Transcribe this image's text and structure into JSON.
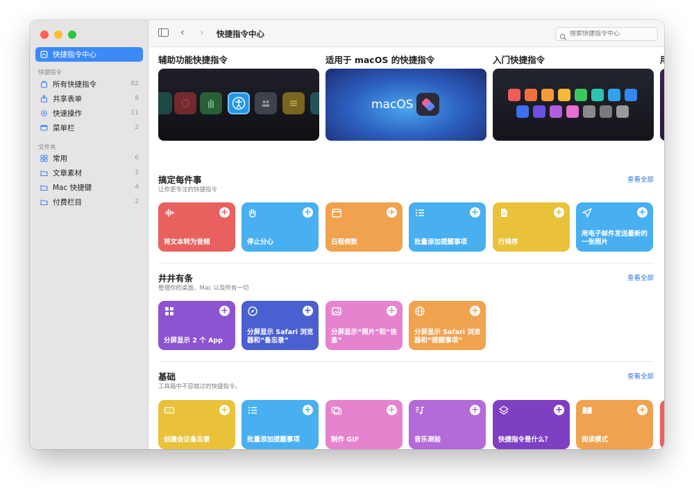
{
  "window": {
    "title": "快捷指令中心"
  },
  "sidebar": {
    "active": {
      "label": "快捷指令中心"
    },
    "section1": "快捷指令",
    "items1": [
      {
        "label": "所有快捷指令",
        "count": "82"
      },
      {
        "label": "共享表单",
        "count": "8"
      },
      {
        "label": "快速操作",
        "count": "11"
      },
      {
        "label": "菜单栏",
        "count": "2"
      }
    ],
    "section2": "文件夹",
    "items2": [
      {
        "label": "常用",
        "count": "6"
      },
      {
        "label": "文章素材",
        "count": "1"
      },
      {
        "label": "Mac 快捷键",
        "count": "4"
      },
      {
        "label": "付费栏目",
        "count": "2"
      }
    ]
  },
  "toolbar": {
    "title": "快捷指令中心",
    "search_placeholder": "搜索快捷指令中心"
  },
  "featured": [
    {
      "title": "辅助功能快捷指令"
    },
    {
      "title": "适用于 macOS 的快捷指令",
      "banner_text": "macOS"
    },
    {
      "title": "入门快捷指令"
    },
    {
      "title": "用"
    }
  ],
  "sections": [
    {
      "title": "搞定每件事",
      "subtitle": "让你更专注的快捷指令",
      "see_all": "查看全部",
      "cards": [
        {
          "label": "将文本转为音频",
          "color": "#e8615f",
          "icon": "waveform-icon"
        },
        {
          "label": "停止分心",
          "color": "#48aff0",
          "icon": "hand-icon"
        },
        {
          "label": "日程倒数",
          "color": "#f0a24f",
          "icon": "calendar-icon"
        },
        {
          "label": "批量添加提醒事项",
          "color": "#48aff0",
          "icon": "list-icon"
        },
        {
          "label": "行排序",
          "color": "#e9c23a",
          "icon": "document-icon"
        },
        {
          "label": "用电子邮件发送最新的一张照片",
          "color": "#48aff0",
          "icon": "paperplane-icon"
        }
      ]
    },
    {
      "title": "井井有条",
      "subtitle": "整理你的桌面、Mac 以及所有一切",
      "see_all": "查看全部",
      "cards": [
        {
          "label": "分屏显示 2 个 App",
          "color": "#8c54d0",
          "icon": "grid-icon"
        },
        {
          "label": "分屏显示 Safari 浏览器和“备忘录”",
          "color": "#4a5fd0",
          "icon": "compass-icon"
        },
        {
          "label": "分屏显示“照片”和“信息”",
          "color": "#e683cf",
          "icon": "photo-icon"
        },
        {
          "label": "分屏显示 Safari 浏览器和“提醒事项”",
          "color": "#f0a24f",
          "icon": "globe-icon"
        }
      ]
    },
    {
      "title": "基础",
      "subtitle": "工具箱中不容错过的快捷指令。",
      "see_all": "查看全部",
      "cards": [
        {
          "label": "创建会议备忘录",
          "color": "#e9c23a",
          "icon": "keyboard-icon"
        },
        {
          "label": "批量添加提醒事项",
          "color": "#48aff0",
          "icon": "list-icon"
        },
        {
          "label": "制作 GIF",
          "color": "#e683cf",
          "icon": "gif-icon"
        },
        {
          "label": "音乐测验",
          "color": "#b46ad8",
          "icon": "music-icon"
        },
        {
          "label": "快捷指令是什么？",
          "color": "#7f3fc3",
          "icon": "layers-icon"
        },
        {
          "label": "阅读模式",
          "color": "#f0a24f",
          "icon": "book-icon"
        }
      ]
    }
  ]
}
